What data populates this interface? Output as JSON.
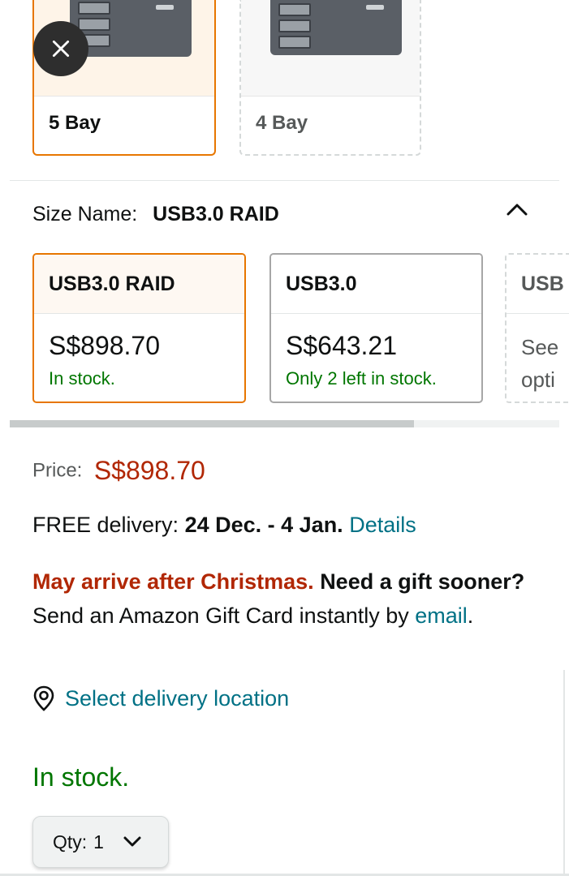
{
  "variants": {
    "style": [
      {
        "label": "5 Bay",
        "selected": true
      },
      {
        "label": "4 Bay",
        "selected": false
      }
    ]
  },
  "size": {
    "label": "Size Name:",
    "selected": "USB3.0 RAID",
    "options": [
      {
        "name": "USB3.0 RAID",
        "price": "S$898.70",
        "stock": "In stock.",
        "selected": true
      },
      {
        "name": "USB3.0",
        "price": "S$643.21",
        "stock": "Only 2 left in stock.",
        "selected": false
      },
      {
        "name": "USB",
        "see": "See",
        "see2": "opti",
        "selected": false
      }
    ]
  },
  "price": {
    "label": "Price:",
    "value": "S$898.70"
  },
  "delivery": {
    "prefix": "FREE delivery:",
    "dates": "24 Dec. - 4 Jan.",
    "link": "Details"
  },
  "christmas": {
    "warning": "May arrive after Christmas.",
    "bold": "Need a gift sooner?",
    "text": "Send an Amazon Gift Card instantly by",
    "link": "email",
    "end": "."
  },
  "location": {
    "link": "Select delivery location"
  },
  "availability": "In stock.",
  "quantity": {
    "label": "Qty:",
    "value": "1"
  },
  "colors": {
    "accent": "#e77600",
    "price": "#b12704",
    "link": "#007185",
    "stock": "#007600"
  },
  "icons": {
    "close": "close-icon",
    "location": "location-pin-icon",
    "chevron": "chevron-icon"
  }
}
